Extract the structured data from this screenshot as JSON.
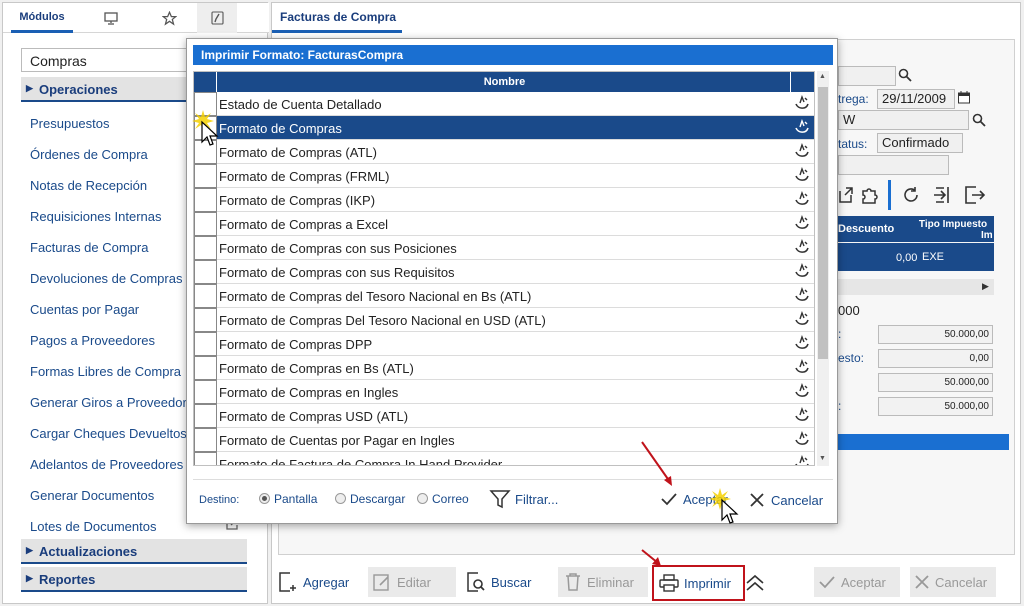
{
  "left": {
    "tabs": {
      "modulos": "Módulos"
    },
    "module_select": "Compras",
    "sections": {
      "operaciones": "Operaciones",
      "actualizaciones": "Actualizaciones",
      "reportes": "Reportes"
    },
    "items": [
      "Presupuestos",
      "Órdenes de Compra",
      "Notas de Recepción",
      "Requisiciones Internas",
      "Facturas de Compra",
      "Devoluciones de Compras",
      "Cuentas por Pagar",
      "Pagos a Proveedores",
      "Formas Libres de Compra",
      "Generar Giros a Proveedores",
      "Cargar Cheques Devueltos",
      "Adelantos de Proveedores",
      "Generar Documentos",
      "Lotes de Documentos"
    ]
  },
  "main": {
    "tab": "Facturas de Compra",
    "fields": {
      "entrega_label": "trega:",
      "entrega_value": "29/11/2009",
      "field_w": "W",
      "status_label": "tatus:",
      "status_value": "Confirmado",
      "col_descuento": "Descuento",
      "col_tipo_impuesto": "Tipo Impuesto",
      "col_im": "Im",
      "row_descuento": "0,00",
      "row_tipo": "EXE",
      "partial_000": "000",
      "lbl_esto": "esto:",
      "num1": "50.000,00",
      "num2": "0,00",
      "num3": "50.000,00",
      "num4": "50.000,00"
    },
    "toolbar": {
      "agregar": "Agregar",
      "editar": "Editar",
      "buscar": "Buscar",
      "eliminar": "Eliminar",
      "imprimir": "Imprimir",
      "aceptar": "Aceptar",
      "cancelar": "Cancelar"
    }
  },
  "modal": {
    "title": "Imprimir Formato: FacturasCompra",
    "column_header": "Nombre",
    "rows": [
      "Estado de Cuenta Detallado",
      "Formato de Compras",
      "Formato de Compras (ATL)",
      "Formato de Compras (FRML)",
      "Formato de Compras (IKP)",
      "Formato de Compras a Excel",
      "Formato de Compras con sus Posiciones",
      "Formato de Compras con sus Requisitos",
      "Formato de Compras del Tesoro Nacional en Bs (ATL)",
      "Formato de Compras Del Tesoro Nacional en USD (ATL)",
      "Formato de Compras DPP",
      "Formato de Compras en Bs (ATL)",
      "Formato de Compras en Ingles",
      "Formato de Compras USD (ATL)",
      "Formato de Cuentas por Pagar en Ingles",
      "Formato de Factura de Compra In Hand Provider"
    ],
    "selected_index": 1,
    "footer": {
      "destino": "Destino:",
      "pantalla": "Pantalla",
      "descargar": "Descargar",
      "correo": "Correo",
      "filtrar": "Filtrar...",
      "aceptar": "Aceptar",
      "cancelar": "Cancelar",
      "selected_destination": "Pantalla"
    }
  },
  "colors": {
    "primary": "#1a4a8a",
    "title_bar": "#1a6fd1",
    "highlight": "#c0131b"
  }
}
